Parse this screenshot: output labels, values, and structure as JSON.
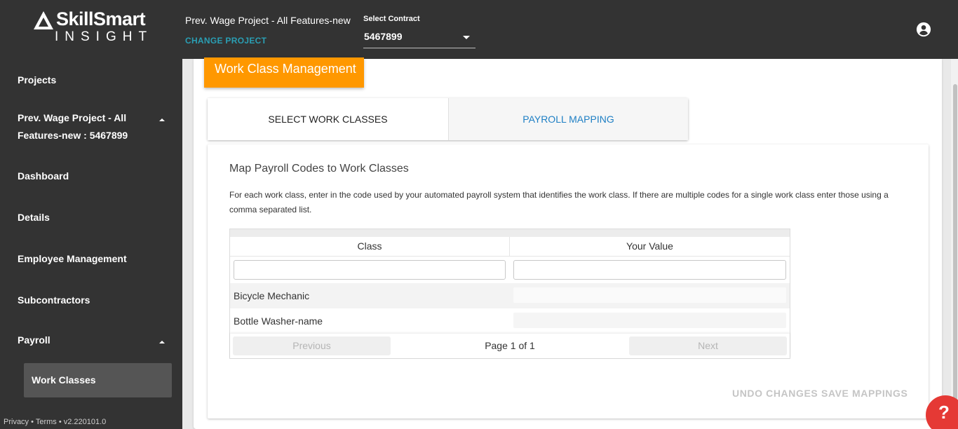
{
  "brand": {
    "line1": "SkillSmart",
    "line2": "INSIGHT"
  },
  "header": {
    "project_title": "Prev. Wage Project - All Features-new",
    "change_project": "CHANGE PROJECT",
    "contract_label": "Select Contract",
    "contract_value": "5467899"
  },
  "sidebar": {
    "projects": "Projects",
    "current_project": "Prev. Wage Project - All Features-new : 5467899",
    "dashboard": "Dashboard",
    "details": "Details",
    "employee_management": "Employee Management",
    "subcontractors": "Subcontractors",
    "payroll": "Payroll",
    "work_classes": "Work Classes"
  },
  "footer": {
    "privacy": "Privacy",
    "sep": " • ",
    "terms": "Terms",
    "version": "v2.220101.0"
  },
  "page": {
    "banner": "Work Class Management",
    "tabs": [
      "SELECT WORK CLASSES",
      "PAYROLL MAPPING"
    ],
    "section_title": "Map Payroll Codes to Work Classes",
    "description": "For each work class, enter in the code used by your automated payroll system that identifies the work class. If there are multiple codes for a single work class enter those using a comma separated list."
  },
  "table": {
    "columns": [
      "Class",
      "Your Value"
    ],
    "rows": [
      {
        "class": "Bicycle Mechanic",
        "value": ""
      },
      {
        "class": "Bottle Washer-name",
        "value": ""
      }
    ],
    "pagination": {
      "previous": "Previous",
      "info": "Page 1 of 1",
      "next": "Next"
    }
  },
  "actions": {
    "undo": "UNDO CHANGES",
    "save": "SAVE MAPPINGS"
  },
  "help": "?",
  "colors": {
    "topbar": "#333333",
    "accent_orange": "#ff9800",
    "link_teal": "#2a9fb4",
    "tab_blue": "#1e7fc4",
    "help_red": "#e53935"
  }
}
